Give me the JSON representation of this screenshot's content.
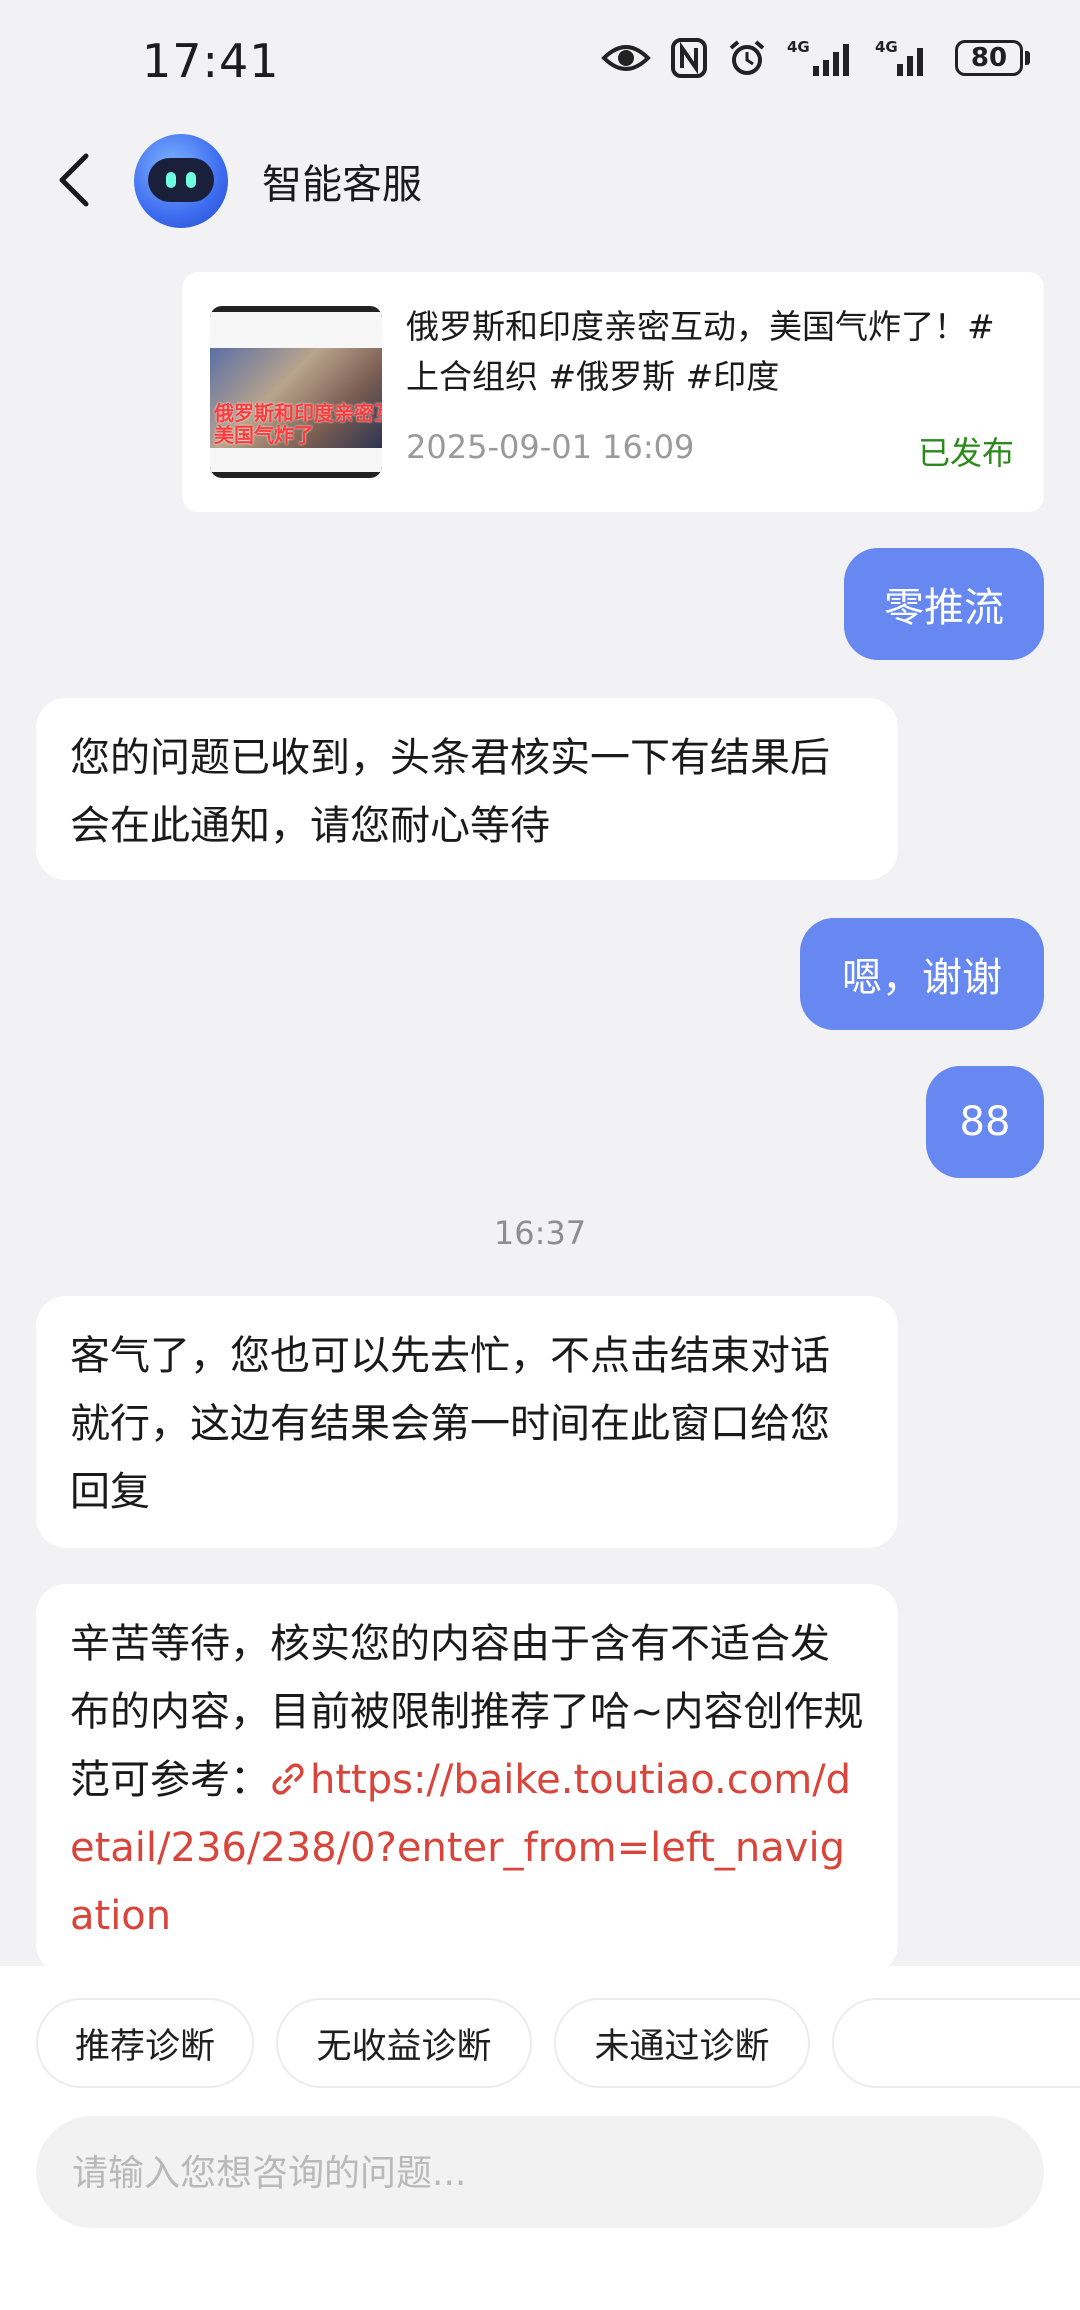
{
  "status_bar": {
    "time": "17:41",
    "icons": [
      "eye-icon",
      "nfc-icon",
      "alarm-icon",
      "signal-4g-icon",
      "signal-4g-icon",
      "battery-icon"
    ],
    "signal_1_label": "4G",
    "signal_2_label": "4G",
    "battery": "80"
  },
  "header": {
    "title": "智能客服",
    "back_icon": "chevron-left-icon"
  },
  "post_card": {
    "thumbnail_caption_line1": "俄罗斯和印度亲密互",
    "thumbnail_caption_line2": "美国气炸了",
    "title": "俄罗斯和印度亲密互动，美国气炸了！#上合组织 #俄罗斯 #印度",
    "date": "2025-09-01 16:09",
    "status": "已发布",
    "status_color": "#2a8a1c"
  },
  "messages": [
    {
      "side": "right",
      "text": "零推流"
    },
    {
      "side": "left",
      "text": "您的问题已收到，头条君核实一下有结果后会在此通知，请您耐心等待"
    },
    {
      "side": "right",
      "text": "嗯，谢谢"
    },
    {
      "side": "right",
      "text": "88"
    },
    {
      "side": "time",
      "text": "16:37"
    },
    {
      "side": "left",
      "text": "客气了，您也可以先去忙，不点击结束对话就行，这边有结果会第一时间在此窗口给您回复"
    },
    {
      "side": "left",
      "text": "辛苦等待，核实您的内容由于含有不适合发布的内容，目前被限制推荐了哈~内容创作规范可参考：",
      "link": "https://baike.toutiao.com/detail/236/238/0?enter_from=left_navigation",
      "link_icon": "link-icon"
    }
  ],
  "quick_actions": [
    "推荐诊断",
    "无收益诊断",
    "未通过诊断"
  ],
  "input": {
    "placeholder": "请输入您想咨询的问题..."
  },
  "colors": {
    "user_bubble": "#6688f0",
    "link": "#d9453b",
    "background": "#f2f2f4"
  }
}
